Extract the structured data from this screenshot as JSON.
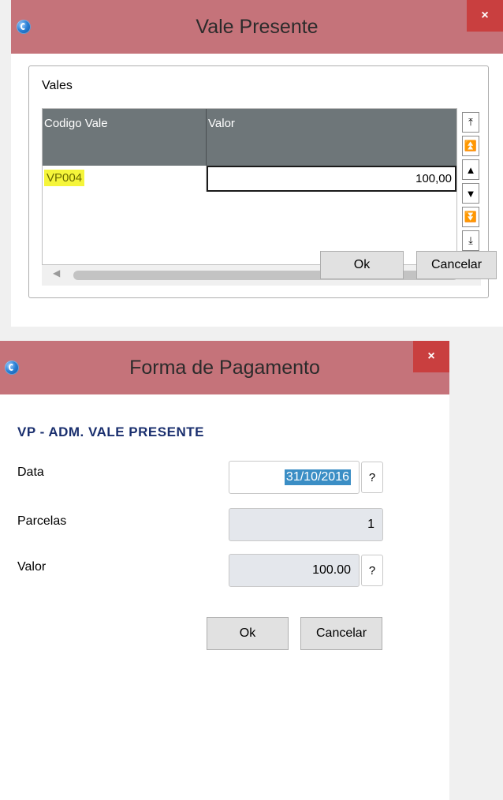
{
  "dialog1": {
    "title": "Vale Presente",
    "close_icon": "×",
    "group_label": "Vales",
    "columns": [
      "Codigo Vale",
      "Valor"
    ],
    "rows": [
      {
        "code": "VP004",
        "value": "100,00"
      }
    ],
    "ok_label": "Ok",
    "cancel_label": "Cancelar"
  },
  "dialog2": {
    "title": "Forma de Pagamento",
    "close_icon": "×",
    "heading": "VP - ADM. VALE PRESENTE",
    "fields": {
      "data": {
        "label": "Data",
        "value": "31/10/2016"
      },
      "parcelas": {
        "label": "Parcelas",
        "value": "1"
      },
      "valor": {
        "label": "Valor",
        "value": "100.00"
      }
    },
    "help_label": "?",
    "ok_label": "Ok",
    "cancel_label": "Cancelar"
  },
  "colors": {
    "title_bar": "#c5737a",
    "close_button": "#c93f3f",
    "grid_header": "#6e7679",
    "highlight": "#f5f53a",
    "selection": "#3b8ec5",
    "heading_text": "#1a2f6e"
  }
}
